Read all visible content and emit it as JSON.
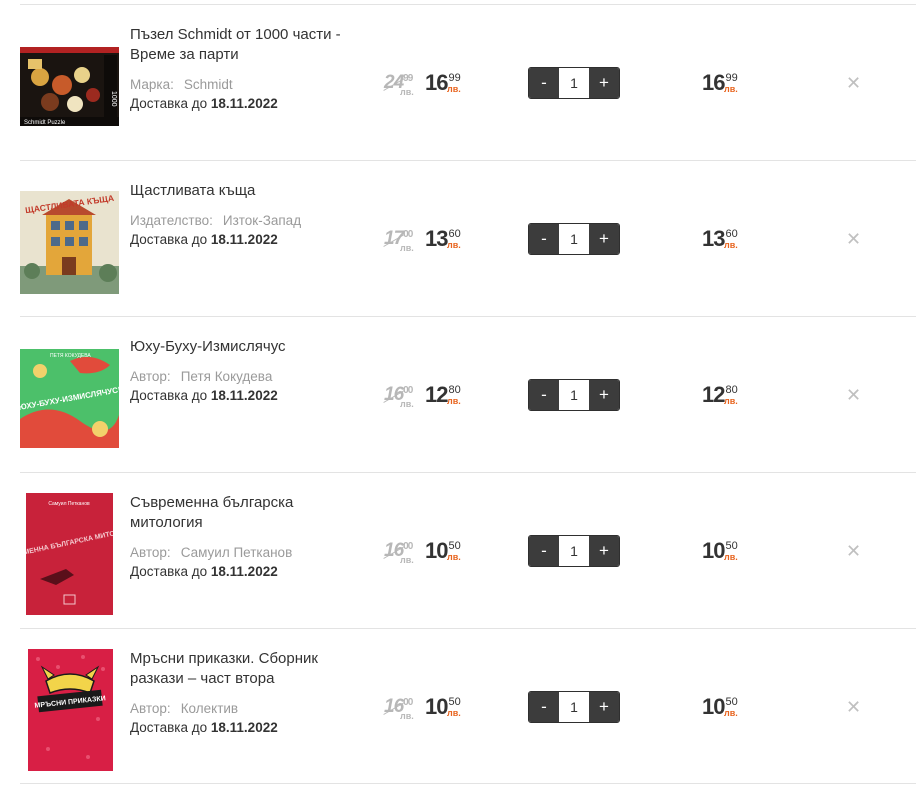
{
  "cart": {
    "items": [
      {
        "title": "Пъзел Schmidt от 1000 части - Време за парти",
        "meta_key": "Марка:",
        "meta_value": "Schmidt",
        "delivery_label": "Доставка до",
        "delivery_date": "18.11.2022",
        "old_price_int": "24",
        "old_price_dec": "99",
        "old_price_cur": "лв.",
        "price_int": "16",
        "price_dec": "99",
        "price_cur": "лв.",
        "quantity": "1",
        "total_int": "16",
        "total_dec": "99",
        "total_cur": "лв.",
        "cover_label": "Schmidt Puzzle",
        "cover_badge": "1000"
      },
      {
        "title": "Щастливата къща",
        "meta_key": "Издателство:",
        "meta_value": "Изток-Запад",
        "delivery_label": "Доставка до",
        "delivery_date": "18.11.2022",
        "old_price_int": "17",
        "old_price_dec": "00",
        "old_price_cur": "лв.",
        "price_int": "13",
        "price_dec": "60",
        "price_cur": "лв.",
        "quantity": "1",
        "total_int": "13",
        "total_dec": "60",
        "total_cur": "лв.",
        "cover_label": "ЩАСТЛИВАТА КЪЩА"
      },
      {
        "title": "Юху-Буху-Измислячус",
        "meta_key": "Автор:",
        "meta_value": "Петя Кокудева",
        "delivery_label": "Доставка до",
        "delivery_date": "18.11.2022",
        "old_price_int": "16",
        "old_price_dec": "00",
        "old_price_cur": "лв.",
        "price_int": "12",
        "price_dec": "80",
        "price_cur": "лв.",
        "quantity": "1",
        "total_int": "12",
        "total_dec": "80",
        "total_cur": "лв.",
        "cover_label": "ЮХУ-БУХУ-ИЗМИСЛЯЧУС!",
        "cover_author": "ПЕТЯ КОКУДЕВА"
      },
      {
        "title": "Съвременна българска митология",
        "meta_key": "Автор:",
        "meta_value": "Самуил Петканов",
        "delivery_label": "Доставка до",
        "delivery_date": "18.11.2022",
        "old_price_int": "16",
        "old_price_dec": "00",
        "old_price_cur": "лв.",
        "price_int": "10",
        "price_dec": "50",
        "price_cur": "лв.",
        "quantity": "1",
        "total_int": "10",
        "total_dec": "50",
        "total_cur": "лв.",
        "cover_label": "СЪВРЕМЕННА БЪЛГАРСКА МИТОЛОГИЯ",
        "cover_author": "Самуил Петканов"
      },
      {
        "title": "Мръсни приказки. Сборник разкази – част втора",
        "meta_key": "Автор:",
        "meta_value": "Колектив",
        "delivery_label": "Доставка до",
        "delivery_date": "18.11.2022",
        "old_price_int": "16",
        "old_price_dec": "00",
        "old_price_cur": "лв.",
        "price_int": "10",
        "price_dec": "50",
        "price_cur": "лв.",
        "quantity": "1",
        "total_int": "10",
        "total_dec": "50",
        "total_cur": "лв.",
        "cover_label": "МРЪСНИ ПРИКАЗКИ"
      }
    ],
    "minus_label": "-",
    "plus_label": "+",
    "remove_icon": "close-icon",
    "colors": {
      "accent": "#e8641e",
      "button": "#3c3c3c",
      "muted": "#9a9a9a"
    }
  }
}
